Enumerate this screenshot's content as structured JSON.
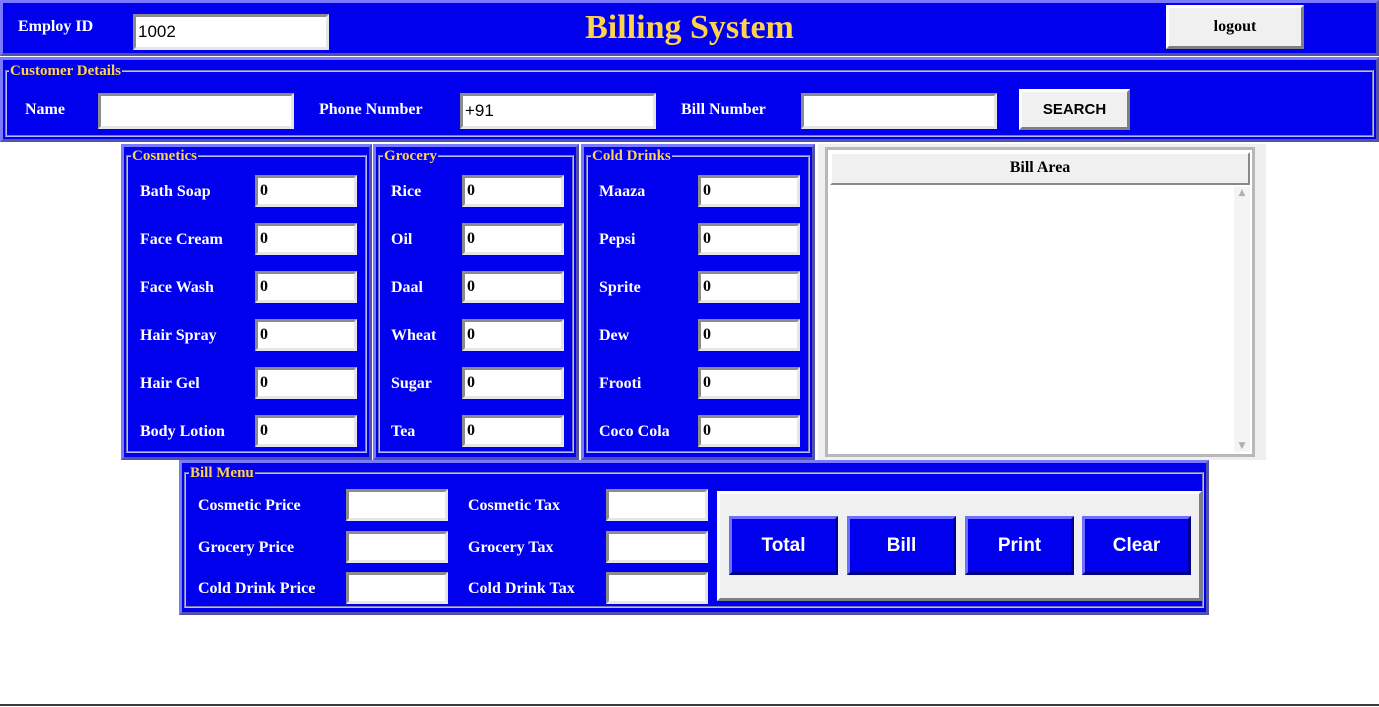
{
  "header": {
    "employ_id_label": "Employ ID",
    "employ_id_value": "1002",
    "title": "Billing System",
    "logout_label": "logout"
  },
  "customer": {
    "legend": "Customer Details",
    "name_label": "Name",
    "name_value": "",
    "phone_label": "Phone Number",
    "phone_value": "+91",
    "bill_label": "Bill Number",
    "bill_value": "",
    "search_label": "SEARCH"
  },
  "cosmetics": {
    "legend": "Cosmetics",
    "items": [
      {
        "label": "Bath Soap",
        "value": "0"
      },
      {
        "label": "Face Cream",
        "value": "0"
      },
      {
        "label": "Face Wash",
        "value": "0"
      },
      {
        "label": "Hair Spray",
        "value": "0"
      },
      {
        "label": "Hair Gel",
        "value": "0"
      },
      {
        "label": "Body Lotion",
        "value": "0"
      }
    ]
  },
  "grocery": {
    "legend": "Grocery",
    "items": [
      {
        "label": "Rice",
        "value": "0"
      },
      {
        "label": "Oil",
        "value": "0"
      },
      {
        "label": "Daal",
        "value": "0"
      },
      {
        "label": "Wheat",
        "value": "0"
      },
      {
        "label": "Sugar",
        "value": "0"
      },
      {
        "label": "Tea",
        "value": "0"
      }
    ]
  },
  "colddrinks": {
    "legend": "Cold Drinks",
    "items": [
      {
        "label": "Maaza",
        "value": "0"
      },
      {
        "label": "Pepsi",
        "value": "0"
      },
      {
        "label": "Sprite",
        "value": "0"
      },
      {
        "label": "Dew",
        "value": "0"
      },
      {
        "label": "Frooti",
        "value": "0"
      },
      {
        "label": "Coco Cola",
        "value": "0"
      }
    ]
  },
  "bill_area": {
    "title": "Bill Area",
    "content": ""
  },
  "bill_menu": {
    "legend": "Bill Menu",
    "cosmetic_price_label": "Cosmetic Price",
    "grocery_price_label": "Grocery Price",
    "colddrink_price_label": "Cold Drink Price",
    "cosmetic_tax_label": "Cosmetic Tax",
    "grocery_tax_label": "Grocery Tax",
    "colddrink_tax_label": "Cold Drink Tax",
    "cosmetic_price_value": "",
    "grocery_price_value": "",
    "colddrink_price_value": "",
    "cosmetic_tax_value": "",
    "grocery_tax_value": "",
    "colddrink_tax_value": "",
    "buttons": {
      "total": "Total",
      "bill": "Bill",
      "print": "Print",
      "clear": "Clear"
    }
  },
  "colors": {
    "panel_blue": "#0000ee",
    "title_gold": "#ffd24d",
    "legend_gold": "#ffd24d",
    "text_white": "#ffffff"
  }
}
